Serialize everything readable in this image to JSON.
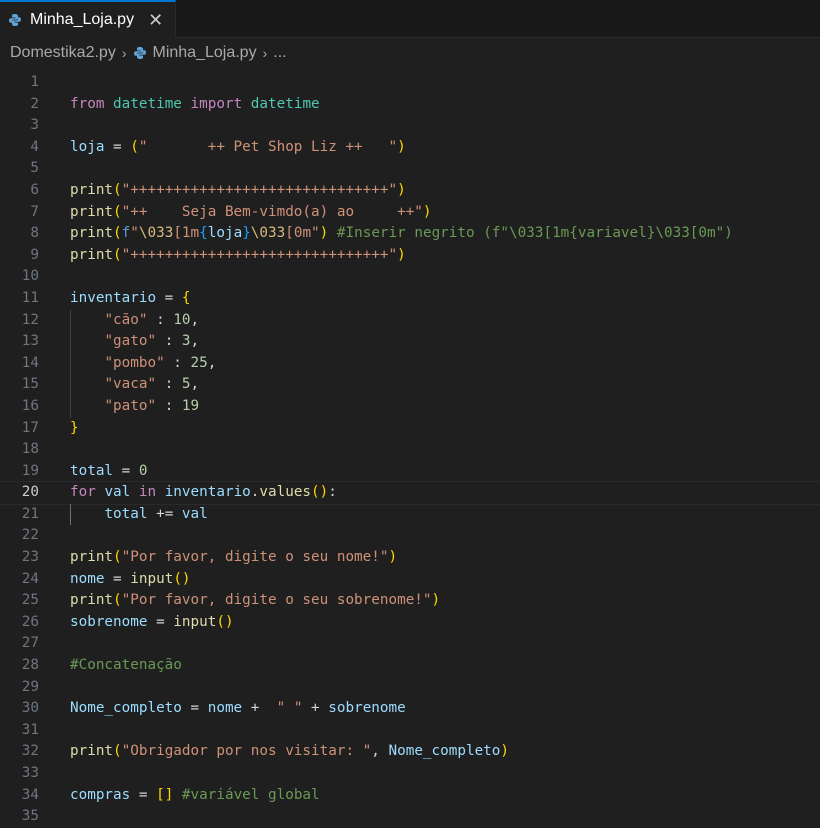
{
  "tab": {
    "filename": "Minha_Loja.py",
    "close_glyph": "✕"
  },
  "breadcrumb": {
    "folder": "Domestika2.py",
    "file": "Minha_Loja.py",
    "more": "..."
  },
  "editor": {
    "current_line": 20
  },
  "code": {
    "l2": [
      "from",
      " ",
      "datetime",
      " ",
      "import",
      " ",
      "datetime"
    ],
    "l4": [
      "loja",
      " = ",
      "(",
      "\"       ++ Pet Shop Liz ++   \"",
      ")"
    ],
    "l6": [
      "print",
      "(",
      "\"++++++++++++++++++++++++++++++\"",
      ")"
    ],
    "l7": [
      "print",
      "(",
      "\"++    Seja Bem-vimdo(a) ao     ++\"",
      ")"
    ],
    "l8": [
      "print",
      "(",
      "f",
      "\"",
      "\\033",
      "[1m",
      "{",
      "loja",
      "}",
      "\\033",
      "[0m\"",
      ")",
      " ",
      "#Inserir negrito (f\"\\033[1m{variavel}\\033[0m\")"
    ],
    "l9": [
      "print",
      "(",
      "\"++++++++++++++++++++++++++++++\"",
      ")"
    ],
    "l11": [
      "inventario",
      " = ",
      "{"
    ],
    "l12": [
      "    ",
      "\"cão\"",
      " : ",
      "10",
      ","
    ],
    "l13": [
      "    ",
      "\"gato\"",
      " : ",
      "3",
      ","
    ],
    "l14": [
      "    ",
      "\"pombo\"",
      " : ",
      "25",
      ","
    ],
    "l15": [
      "    ",
      "\"vaca\"",
      " : ",
      "5",
      ","
    ],
    "l16": [
      "    ",
      "\"pato\"",
      " : ",
      "19"
    ],
    "l17": [
      "}"
    ],
    "l19": [
      "total",
      " = ",
      "0"
    ],
    "l20": [
      "for",
      " ",
      "val",
      " ",
      "in",
      " ",
      "inventario",
      ".",
      "values",
      "(",
      ")",
      ":"
    ],
    "l21": [
      "    ",
      "total",
      " += ",
      "val"
    ],
    "l23": [
      "print",
      "(",
      "\"Por favor, digite o seu nome!\"",
      ")"
    ],
    "l24": [
      "nome",
      " = ",
      "input",
      "(",
      ")"
    ],
    "l25": [
      "print",
      "(",
      "\"Por favor, digite o seu sobrenome!\"",
      ")"
    ],
    "l26": [
      "sobrenome",
      " = ",
      "input",
      "(",
      ")"
    ],
    "l28": [
      "#Concatenação"
    ],
    "l30": [
      "Nome_completo",
      " = ",
      "nome",
      " +  ",
      "\" \"",
      " + ",
      "sobrenome"
    ],
    "l32": [
      "print",
      "(",
      "\"Obrigador por nos visitar: \"",
      ", ",
      "Nome_completo",
      ")"
    ],
    "l34": [
      "compras",
      " = ",
      "[",
      "]",
      " ",
      "#variável global"
    ]
  }
}
